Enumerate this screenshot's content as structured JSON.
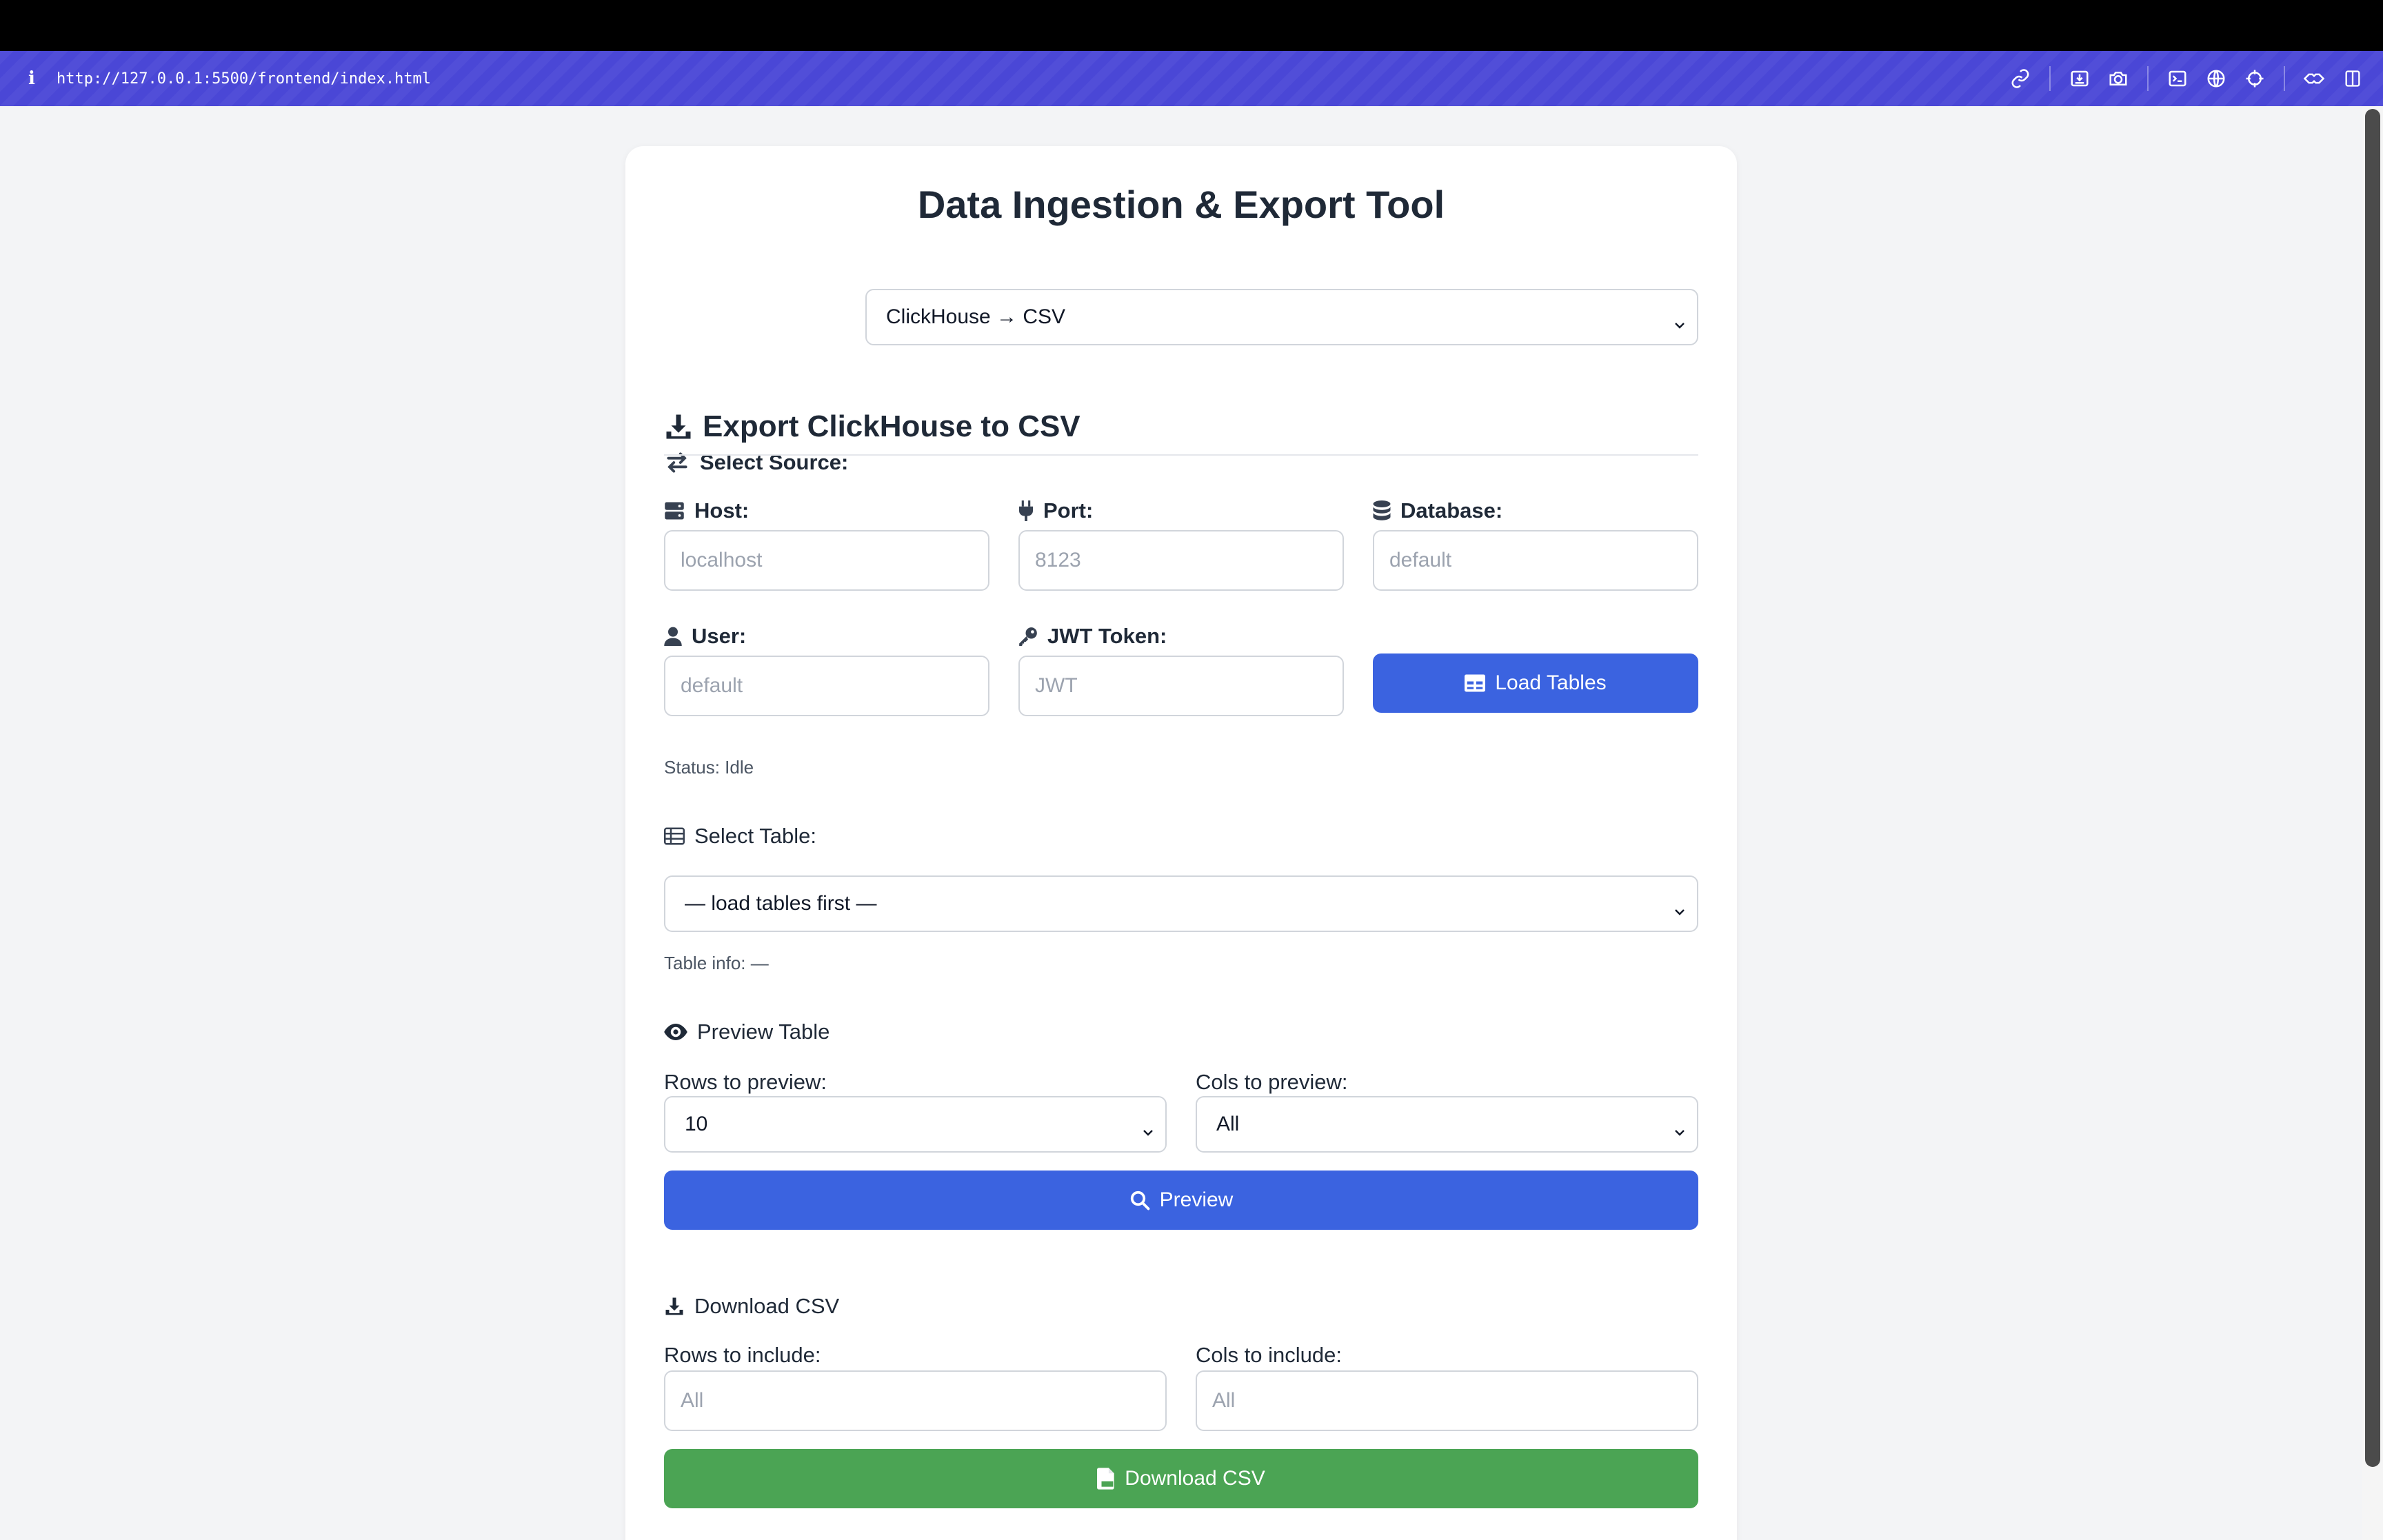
{
  "browser": {
    "url": "http://127.0.0.1:5500/frontend/index.html",
    "info_icon": "info-icon",
    "toolbar_icons": [
      "link-icon",
      "download-icon",
      "camera-icon",
      "terminal-icon",
      "globe-icon",
      "crosshair-icon",
      "extension-icon",
      "sidebar-icon"
    ]
  },
  "app": {
    "title": "Data Ingestion & Export Tool",
    "source": {
      "label": "Select Source:",
      "value": "ClickHouse → CSV",
      "icon": "swap-icon"
    },
    "section_title": "Export ClickHouse to CSV",
    "connection": {
      "host": {
        "label": "Host:",
        "placeholder": "localhost"
      },
      "port": {
        "label": "Port:",
        "placeholder": "8123"
      },
      "database": {
        "label": "Database:",
        "placeholder": "default"
      },
      "user": {
        "label": "User:",
        "placeholder": "default"
      },
      "jwt": {
        "label": "JWT Token:",
        "placeholder": "JWT"
      },
      "load_button": "Load Tables"
    },
    "status": "Status: Idle",
    "table": {
      "label": "Select Table:",
      "value": "— load tables first —",
      "info": "Table info: —"
    },
    "preview": {
      "heading": "Preview Table",
      "rows_label": "Rows to preview:",
      "rows_value": "10",
      "cols_label": "Cols to preview:",
      "cols_value": "All",
      "button": "Preview"
    },
    "download": {
      "heading": "Download CSV",
      "rows_label": "Rows to include:",
      "rows_placeholder": "All",
      "cols_label": "Cols to include:",
      "cols_placeholder": "All",
      "button": "Download CSV"
    }
  },
  "colors": {
    "url_bar": "#4a47d6",
    "primary_button": "#3b63e0",
    "download_button": "#4ba454",
    "page_background": "#f3f4f6"
  }
}
